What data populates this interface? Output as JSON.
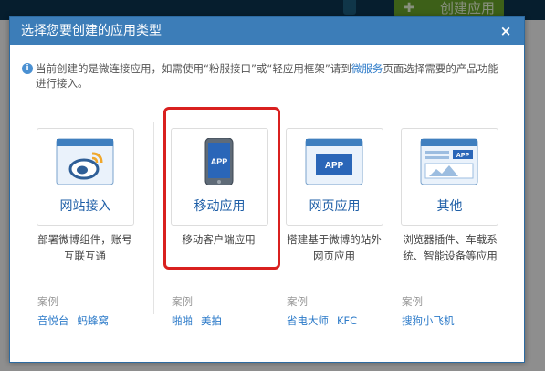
{
  "background": {
    "create_button_label": "创建应用"
  },
  "dialog": {
    "title": "选择您要创建的应用类型",
    "close_glyph": "×",
    "notice": {
      "text_1": "当前创建的是微连接应用，如需使用“粉服接口”或“轻应用框架”请到",
      "link": "微服务",
      "text_2": "页面选择需要的产品功能进行接入。"
    },
    "options": [
      {
        "label": "网站接入",
        "desc_line1": "部署微博组件，账号",
        "desc_line2": "互联互通",
        "icon": "weibo-logo-icon"
      },
      {
        "label": "移动应用",
        "desc_line1": "移动客户端应用",
        "desc_line2": "",
        "icon": "phone-app-icon",
        "icon_text": "APP"
      },
      {
        "label": "网页应用",
        "desc_line1": "搭建基于微博的站外",
        "desc_line2": "网页应用",
        "icon": "web-app-icon",
        "icon_text": "APP"
      },
      {
        "label": "其他",
        "desc_line1": "浏览器插件、车载系",
        "desc_line2": "统、智能设备等应用",
        "icon": "other-app-icon",
        "icon_text": "APP"
      }
    ],
    "cases_label": "案例",
    "cases": [
      [
        "音悦台",
        "蚂蜂窝"
      ],
      [
        "啪啪",
        "美拍"
      ],
      [
        "省电大师",
        "KFC"
      ],
      [
        "搜狗小飞机"
      ]
    ]
  },
  "colors": {
    "title_bar": "#3c7db8",
    "link": "#2d7bc9",
    "selection": "#d9201f"
  }
}
